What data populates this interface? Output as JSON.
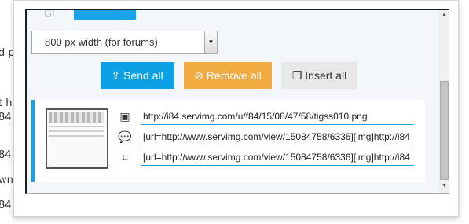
{
  "background": {
    "fragments": [
      "d p",
      "t h",
      "84",
      "84",
      "wn",
      "84"
    ]
  },
  "tabs": {
    "ghost_label": "GI"
  },
  "resize": {
    "selected": "800 px width (for forums)"
  },
  "buttons": {
    "send_all": "Send all",
    "remove_all": "Remove all",
    "insert_all": "Insert all"
  },
  "image": {
    "direct_link": "http://i84.servimg.com/u/f84/15/08/47/58/tigss010.png",
    "forum_code": "[url=http://www.servimg.com/view/15084758/6336][img]http://i84",
    "thumb_code": "[url=http://www.servimg.com/view/15084758/6336][img]http://i84"
  },
  "colors": {
    "accent": "#1aa3e8",
    "send": "#0ea0e5",
    "remove": "#f0ab41",
    "insert": "#e7e7e7"
  }
}
